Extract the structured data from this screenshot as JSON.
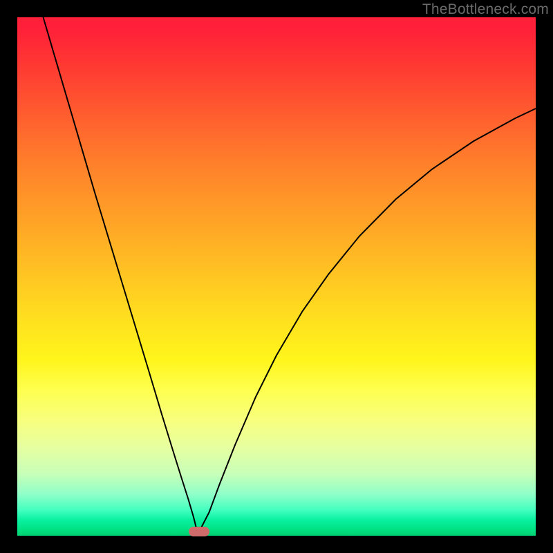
{
  "watermark": "TheBottleneck.com",
  "chart_data": {
    "type": "line",
    "title": "",
    "xlabel": "",
    "ylabel": "",
    "xlim": [
      0,
      100
    ],
    "ylim": [
      0,
      100
    ],
    "grid": false,
    "series": [
      {
        "name": "curve",
        "x": [
          5,
          10,
          15,
          20,
          25,
          28,
          30,
          31.5,
          33,
          34,
          34.5,
          35.5,
          37,
          39,
          42,
          46,
          50,
          55,
          60,
          66,
          73,
          80,
          88,
          96,
          100
        ],
        "values": [
          100,
          83,
          66,
          49.5,
          33,
          23,
          16.5,
          11.7,
          7,
          3.6,
          1.6,
          1.6,
          4.5,
          9.9,
          17.5,
          26.8,
          34.8,
          43.3,
          50.4,
          57.8,
          64.9,
          70.7,
          76.1,
          80.5,
          82.4
        ]
      }
    ],
    "marker": {
      "x": 35,
      "y": 0.8
    },
    "background_gradient": {
      "top": "#ff1f3a",
      "mid": "#fff51b",
      "bottom": "#00d070"
    }
  }
}
